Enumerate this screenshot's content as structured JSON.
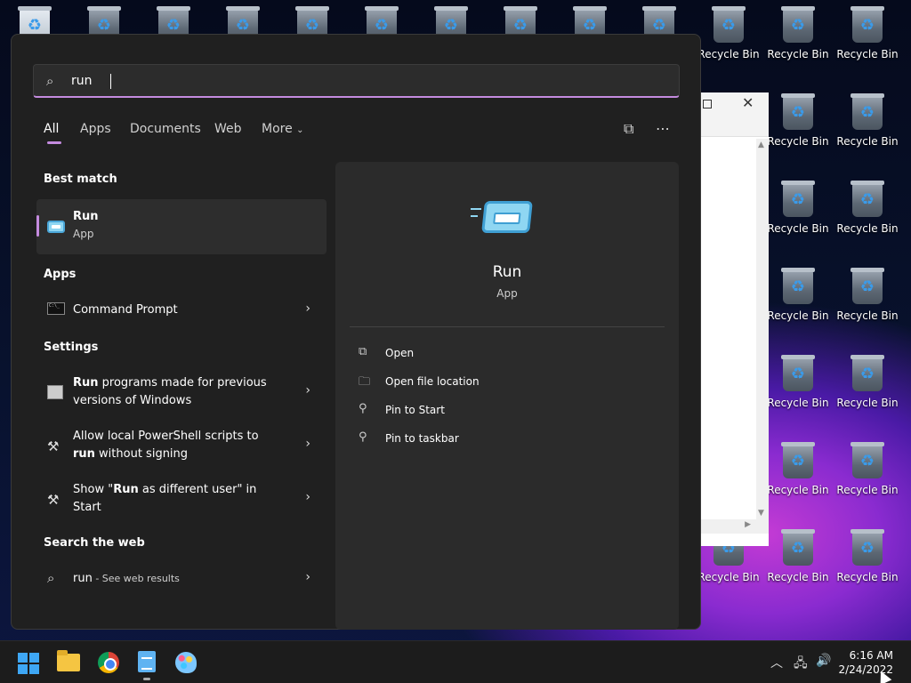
{
  "desktop": {
    "icon_label": "Recycle Bin",
    "icons": [
      {
        "col": 0,
        "row": 0,
        "label": "Recycle Bin"
      },
      {
        "col": 1,
        "row": 0,
        "label": "Recycle Bin"
      },
      {
        "col": 2,
        "row": 0,
        "label": "Recycle Bin"
      },
      {
        "col": 1,
        "row": 1,
        "label": "Recycle Bin"
      },
      {
        "col": 2,
        "row": 1,
        "label": "Recycle Bin"
      },
      {
        "col": 1,
        "row": 2,
        "label": "Recycle Bin"
      },
      {
        "col": 2,
        "row": 2,
        "label": "Recycle Bin"
      },
      {
        "col": 1,
        "row": 3,
        "label": "Recycle Bin"
      },
      {
        "col": 2,
        "row": 3,
        "label": "Recycle Bin"
      },
      {
        "col": 1,
        "row": 4,
        "label": "Recycle Bin"
      },
      {
        "col": 2,
        "row": 4,
        "label": "Recycle Bin"
      },
      {
        "col": 1,
        "row": 5,
        "label": "Recycle Bin"
      },
      {
        "col": 2,
        "row": 5,
        "label": "Recycle Bin"
      },
      {
        "col": 0,
        "row": 6,
        "label": "Recycle Bin"
      },
      {
        "col": 1,
        "row": 6,
        "label": "Recycle Bin"
      },
      {
        "col": 2,
        "row": 6,
        "label": "Recycle Bin"
      }
    ]
  },
  "search": {
    "value": "run",
    "icon": "search-icon"
  },
  "tabs": [
    {
      "label": "All",
      "active": true
    },
    {
      "label": "Apps"
    },
    {
      "label": "Documents"
    },
    {
      "label": "Web"
    },
    {
      "label": "More"
    }
  ],
  "tab_icons": [
    "share-icon",
    "more-icon"
  ],
  "best_match": {
    "heading": "Best match",
    "title": "Run",
    "subtitle": "App"
  },
  "apps": {
    "heading": "Apps",
    "items": [
      {
        "label": "Command Prompt"
      }
    ]
  },
  "settings": {
    "heading": "Settings",
    "items": [
      {
        "bold": "Run",
        "rest": " programs made for previous versions of Windows"
      },
      {
        "pre": "Allow local PowerShell scripts to ",
        "bold": "run",
        "rest": " without signing"
      },
      {
        "pre": "Show \"",
        "bold": "Run",
        "rest": " as different user\" in Start"
      }
    ]
  },
  "web": {
    "heading": "Search the web",
    "query": "run",
    "suffix": " - See web results"
  },
  "preview": {
    "title": "Run",
    "subtitle": "App",
    "actions": [
      {
        "label": "Open",
        "icon": "open-icon"
      },
      {
        "label": "Open file location",
        "icon": "folder-icon"
      },
      {
        "label": "Pin to Start",
        "icon": "pin-icon"
      },
      {
        "label": "Pin to taskbar",
        "icon": "pin-icon"
      }
    ]
  },
  "taskbar": {
    "time": "6:16 AM",
    "date": "2/24/2022"
  },
  "colors": {
    "accent": "#c48bdf",
    "panel_bg": "#202020",
    "windows_blue": "#3ea7f5"
  }
}
